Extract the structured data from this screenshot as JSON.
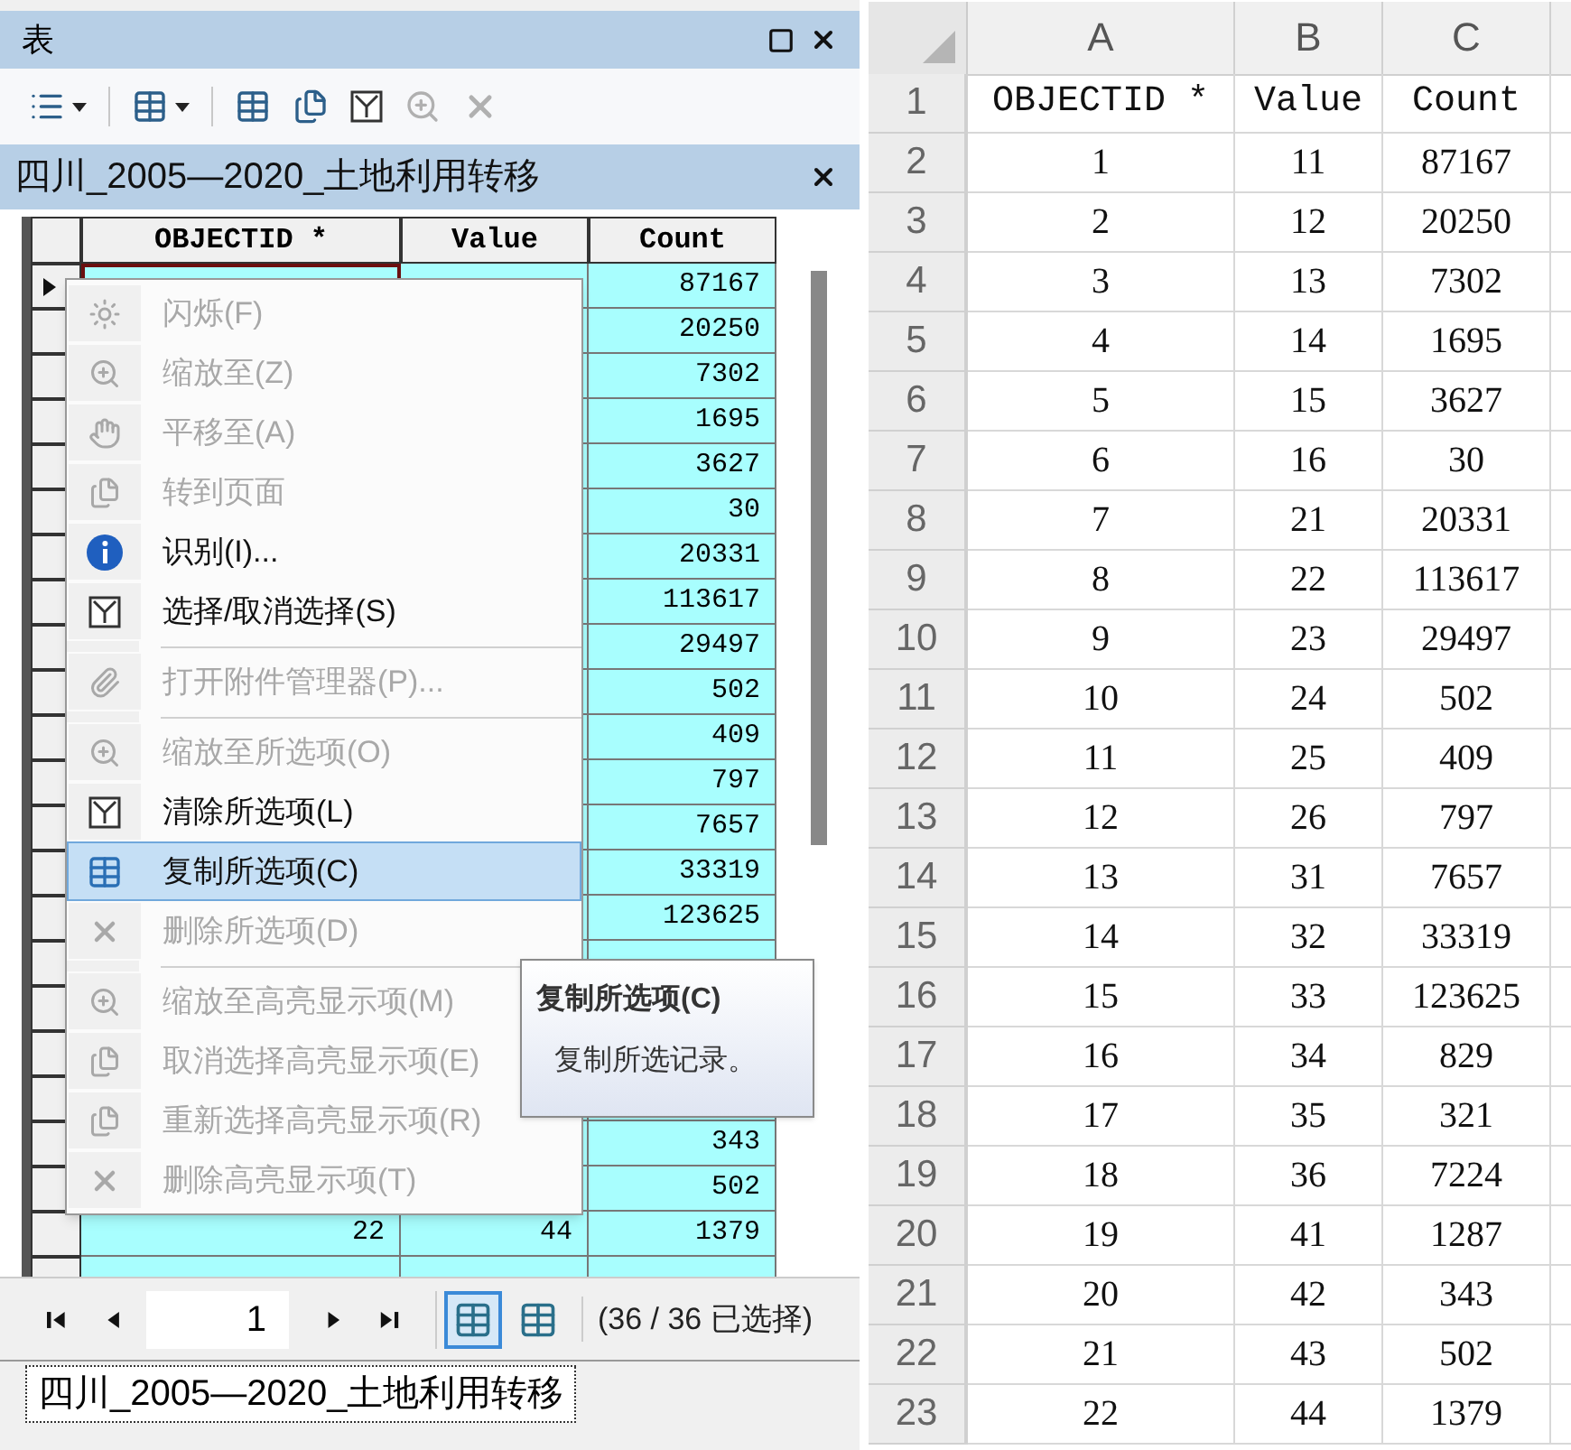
{
  "window": {
    "title": "表"
  },
  "toolbar": [
    {
      "dropdown": true,
      "disabled": false
    },
    {
      "dropdown": true,
      "disabled": false
    },
    {
      "dropdown": false,
      "disabled": false
    },
    {
      "dropdown": false,
      "disabled": false
    },
    {
      "dropdown": false,
      "disabled": false
    },
    {
      "dropdown": false,
      "disabled": true
    },
    {
      "dropdown": false,
      "disabled": true
    }
  ],
  "table_title": "四川_2005—2020_土地利用转移",
  "table": {
    "columns": [
      "OBJECTID *",
      "Value",
      "Count"
    ],
    "rows": [
      {
        "current": true
      },
      {
        "current": false,
        "count": "20250"
      },
      {
        "current": false,
        "count": "7302"
      },
      {
        "current": false,
        "count": "1695"
      },
      {
        "current": false,
        "count": "3627"
      },
      {
        "current": false,
        "count": "30"
      },
      {
        "current": false,
        "count": "20331"
      },
      {
        "current": false,
        "count": "113617"
      },
      {
        "current": false,
        "count": "29497"
      },
      {
        "current": false,
        "count": "502"
      },
      {
        "current": false,
        "count": "409"
      },
      {
        "current": false,
        "count": "797"
      },
      {
        "current": false,
        "count": "7657"
      },
      {
        "current": false,
        "count": "33319"
      },
      {
        "current": false,
        "count": "123625"
      },
      {
        "current": false
      },
      {
        "current": false
      },
      {
        "current": false
      },
      {
        "current": false
      },
      {
        "current": false,
        "count": "343"
      },
      {
        "current": false,
        "count": "502"
      },
      {
        "current": false,
        "objectid": "22",
        "value": "44",
        "count": "1379"
      },
      {
        "current": false
      }
    ],
    "first_count": "87167"
  },
  "context_menu": [
    {
      "kind": "item",
      "label": "闪烁(F)",
      "disabled": true,
      "selected": false
    },
    {
      "kind": "item",
      "label": "缩放至(Z)",
      "disabled": true,
      "selected": false
    },
    {
      "kind": "item",
      "label": "平移至(A)",
      "disabled": true,
      "selected": false
    },
    {
      "kind": "item",
      "label": "转到页面",
      "disabled": true,
      "selected": false
    },
    {
      "kind": "item",
      "label": "识别(I)...",
      "disabled": false,
      "selected": false
    },
    {
      "kind": "item",
      "label": "选择/取消选择(S)",
      "disabled": false,
      "selected": false
    },
    {
      "kind": "separator"
    },
    {
      "kind": "item",
      "label": "打开附件管理器(P)...",
      "disabled": true,
      "selected": false
    },
    {
      "kind": "separator"
    },
    {
      "kind": "item",
      "label": "缩放至所选项(O)",
      "disabled": true,
      "selected": false
    },
    {
      "kind": "item",
      "label": "清除所选项(L)",
      "disabled": false,
      "selected": false
    },
    {
      "kind": "item",
      "label": "复制所选项(C)",
      "disabled": false,
      "selected": true
    },
    {
      "kind": "item",
      "label": "删除所选项(D)",
      "disabled": true,
      "selected": false
    },
    {
      "kind": "separator"
    },
    {
      "kind": "item",
      "label": "缩放至高亮显示项(M)",
      "disabled": true,
      "selected": false
    },
    {
      "kind": "item",
      "label": "取消选择高亮显示项(E)",
      "disabled": true,
      "selected": false
    },
    {
      "kind": "item",
      "label": "重新选择高亮显示项(R)",
      "disabled": true,
      "selected": false
    },
    {
      "kind": "item",
      "label": "删除高亮显示项(T)",
      "disabled": true,
      "selected": false
    }
  ],
  "tooltip": {
    "title": "复制所选项(C)",
    "text": "复制所选记录。"
  },
  "navigation": {
    "page": "1",
    "views": [
      {
        "selected": true
      },
      {
        "selected": false
      }
    ],
    "status": "(36 / 36 已选择)"
  },
  "bottom_tab": {
    "label": "四川_2005—2020_土地利用转移",
    "selected": true
  },
  "sheet": {
    "columns": [
      "A",
      "B",
      "C"
    ],
    "rows": [
      {
        "number": "1",
        "cells": [
          "OBJECTID *",
          "Value",
          "Count"
        ]
      },
      {
        "number": "2",
        "cells": [
          "1",
          "11",
          "87167"
        ]
      },
      {
        "number": "3",
        "cells": [
          "2",
          "12",
          "20250"
        ]
      },
      {
        "number": "4",
        "cells": [
          "3",
          "13",
          "7302"
        ]
      },
      {
        "number": "5",
        "cells": [
          "4",
          "14",
          "1695"
        ]
      },
      {
        "number": "6",
        "cells": [
          "5",
          "15",
          "3627"
        ]
      },
      {
        "number": "7",
        "cells": [
          "6",
          "16",
          "30"
        ]
      },
      {
        "number": "8",
        "cells": [
          "7",
          "21",
          "20331"
        ]
      },
      {
        "number": "9",
        "cells": [
          "8",
          "22",
          "113617"
        ]
      },
      {
        "number": "10",
        "cells": [
          "9",
          "23",
          "29497"
        ]
      },
      {
        "number": "11",
        "cells": [
          "10",
          "24",
          "502"
        ]
      },
      {
        "number": "12",
        "cells": [
          "11",
          "25",
          "409"
        ]
      },
      {
        "number": "13",
        "cells": [
          "12",
          "26",
          "797"
        ]
      },
      {
        "number": "14",
        "cells": [
          "13",
          "31",
          "7657"
        ]
      },
      {
        "number": "15",
        "cells": [
          "14",
          "32",
          "33319"
        ]
      },
      {
        "number": "16",
        "cells": [
          "15",
          "33",
          "123625"
        ]
      },
      {
        "number": "17",
        "cells": [
          "16",
          "34",
          "829"
        ]
      },
      {
        "number": "18",
        "cells": [
          "17",
          "35",
          "321"
        ]
      },
      {
        "number": "19",
        "cells": [
          "18",
          "36",
          "7224"
        ]
      },
      {
        "number": "20",
        "cells": [
          "19",
          "41",
          "1287"
        ]
      },
      {
        "number": "21",
        "cells": [
          "20",
          "42",
          "343"
        ]
      },
      {
        "number": "22",
        "cells": [
          "21",
          "43",
          "502"
        ]
      },
      {
        "number": "23",
        "cells": [
          "22",
          "44",
          "1379"
        ]
      }
    ]
  }
}
